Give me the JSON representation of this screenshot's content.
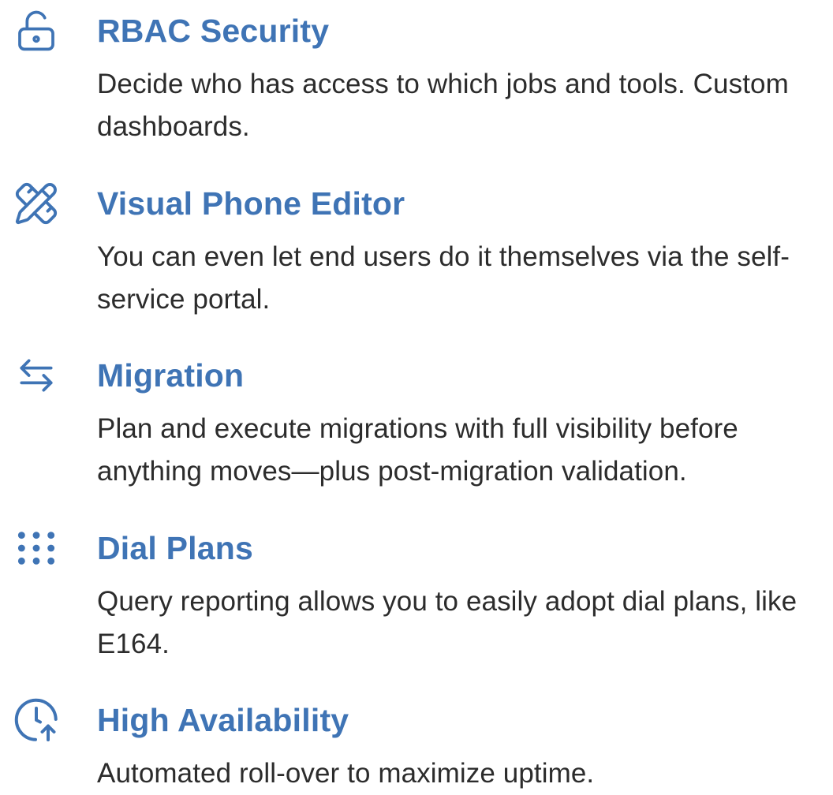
{
  "features": [
    {
      "icon": "unlock-icon",
      "title": "RBAC Security",
      "description": "Decide who has access to which jobs and tools. Custom dashboards."
    },
    {
      "icon": "pencil-ruler-icon",
      "title": "Visual Phone Editor",
      "description": "You can even let end users do it themselves via the self-service portal."
    },
    {
      "icon": "arrows-exchange-icon",
      "title": "Migration",
      "description": "Plan and execute migrations with full visibility before anything moves—plus post-migration validation."
    },
    {
      "icon": "dialpad-icon",
      "title": "Dial Plans",
      "description": "Query reporting allows you to easily adopt dial plans, like E164."
    },
    {
      "icon": "clock-up-icon",
      "title": "High Availability",
      "description": "Automated roll-over to maximize uptime."
    }
  ],
  "colors": {
    "accent": "#3f74b5",
    "text": "#2c2c2c",
    "background": "#ffffff"
  }
}
